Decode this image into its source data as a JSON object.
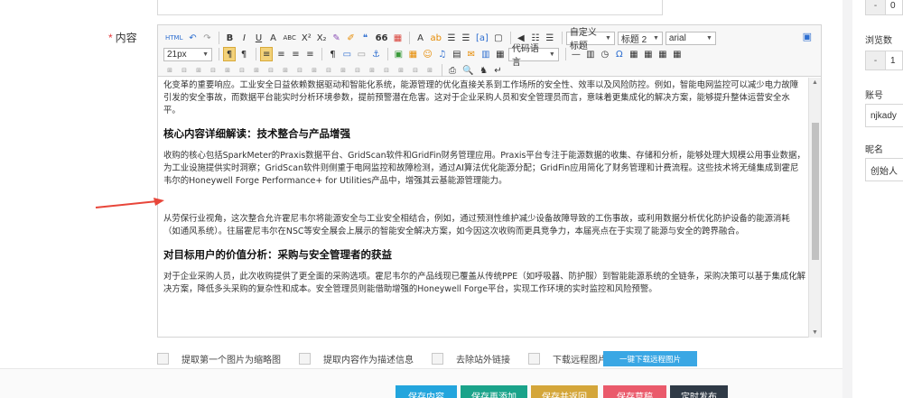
{
  "field": {
    "required_mark": "*",
    "label": "内容"
  },
  "toolbar": {
    "row1": [
      "HTML",
      "↶",
      "↷",
      "B",
      "I",
      "U",
      "A",
      "ABC",
      "X²",
      "X₂",
      "✎",
      "✐",
      "❝",
      "66",
      "▦",
      "A",
      "ab",
      "☰",
      "☰",
      "[a]",
      "▢",
      "◀",
      "☷",
      "☰"
    ],
    "custom_title": "自定义标题",
    "heading": "标题 2",
    "font": "arial",
    "fontsize": "21px",
    "row2": [
      "¶",
      "¶",
      "≡",
      "≡",
      "≡",
      "≡",
      "¶",
      "▭",
      "▭",
      "⚓",
      "▣",
      "▦",
      "☺",
      "♫",
      "▤",
      "✉",
      "▥",
      "▦"
    ],
    "code_lang": "代码语言",
    "row2b": [
      "—",
      "▥",
      "◷",
      "Ω",
      "▦",
      "▦",
      "▦",
      "▦"
    ],
    "row3": [
      "⊞",
      "⊟",
      "⊞",
      "⊟",
      "⊞",
      "⊟",
      "⊞",
      "⊟",
      "⊞",
      "⊟",
      "⊞",
      "⊟",
      "⊞",
      "⊟",
      "⊞",
      "⊟",
      "⊞",
      "⊟",
      "⊞"
    ],
    "row3b": [
      "⎙",
      "🔍",
      "♞",
      "↵"
    ]
  },
  "content": {
    "p0": "化变革的重要响应。工业安全日益依赖数据驱动和智能化系统，能源管理的优化直接关系到工作场所的安全性、效率以及风险防控。例如，智能电网监控可以减少电力故障引发的安全事故，而数据平台能实时分析环境参数，提前预警潜在危害。这对于企业采购人员和安全管理员而言，意味着更集成化的解决方案，能够提升整体运营安全水平。",
    "h1": "核心内容详细解读：技术整合与产品增强",
    "p1": "收购的核心包括SparkMeter的Praxis数据平台、GridScan软件和GridFin财务管理应用。Praxis平台专注于能源数据的收集、存储和分析，能够处理大规模公用事业数据，为工业设施提供实时洞察；GridScan软件则侧重于电网监控和故障检测，通过AI算法优化能源分配；GridFin应用简化了财务管理和计费流程。这些技术将无缝集成到霍尼韦尔的Honeywell Forge Performance+ for Utilities产品中，增强其云基能源管理能力。",
    "p2": "从劳保行业视角，这次整合允许霍尼韦尔将能源安全与工业安全相结合，例如，通过预测性维护减少设备故障导致的工伤事故，或利用数据分析优化防护设备的能源消耗（如通风系统）。往届霍尼韦尔在NSC等安全展会上展示的智能安全解决方案，如今因这次收购而更具竞争力，本届亮点在于实现了能源与安全的跨界融合。",
    "h2": "对目标用户的价值分析：采购与安全管理者的获益",
    "p3": "对于企业采购人员，此次收购提供了更全面的采购选项。霍尼韦尔的产品线现已覆盖从传统PPE（如呼吸器、防护服）到智能能源系统的全链条，采购决策可以基于集成化解决方案，降低多头采购的复杂性和成本。安全管理员则能借助增强的Honeywell Forge平台，实现工作环境的实时监控和风险预警。"
  },
  "options": [
    {
      "label": "提取第一个图片为缩略图"
    },
    {
      "label": "提取内容作为描述信息"
    },
    {
      "label": "去除站外链接"
    },
    {
      "label": "下载远程图片"
    }
  ],
  "download_button": "一键下载远程图片",
  "actions": {
    "save_content": "保存内容",
    "save_add": "保存再添加",
    "save_return": "保存并返回",
    "save_draft": "保存草稿",
    "schedule": "定时发布"
  },
  "sidebar": {
    "stepper1": {
      "minus": "-",
      "value": "0"
    },
    "views_label": "浏览数",
    "stepper2": {
      "minus": "-",
      "value": "1"
    },
    "account_label": "账号",
    "account_value": "njkady",
    "nickname_label": "昵名",
    "nickname_value": "创始人"
  },
  "colors": {
    "primary": "#23a5dd",
    "teal": "#1aa38a",
    "gold": "#d4a63a",
    "pink": "#ea5a6b",
    "dark": "#2f3a46",
    "arrow": "#e8463a"
  }
}
